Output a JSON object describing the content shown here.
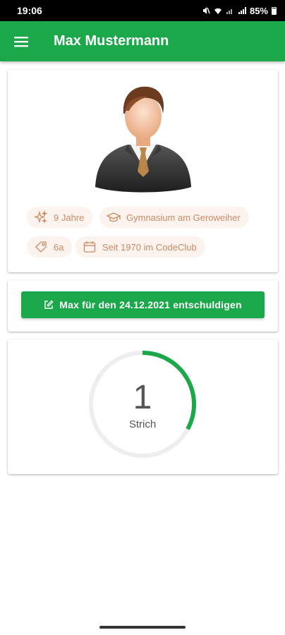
{
  "status_bar": {
    "time": "19:06",
    "battery": "85%"
  },
  "app_bar": {
    "title": "Max Mustermann",
    "menu_icon": "hamburger-menu-icon"
  },
  "profile": {
    "chips": [
      {
        "icon": "sparkles-icon",
        "label": "9 Jahre"
      },
      {
        "icon": "graduation-cap-icon",
        "label": "Gymnasium am Geroweiher"
      },
      {
        "icon": "tag-icon",
        "label": "6a"
      },
      {
        "icon": "calendar-icon",
        "label": "Seit 1970 im CodeClub"
      }
    ]
  },
  "excuse": {
    "button_label": "Max für den 24.12.2021 entschuldigen",
    "icon": "edit-icon"
  },
  "counter": {
    "value": "1",
    "label": "Strich",
    "progress_fraction": 0.33
  },
  "colors": {
    "primary": "#1ba84a",
    "chip_bg": "#fdf3ee",
    "chip_text": "#c98a64",
    "ring_track": "#eeeeee"
  }
}
